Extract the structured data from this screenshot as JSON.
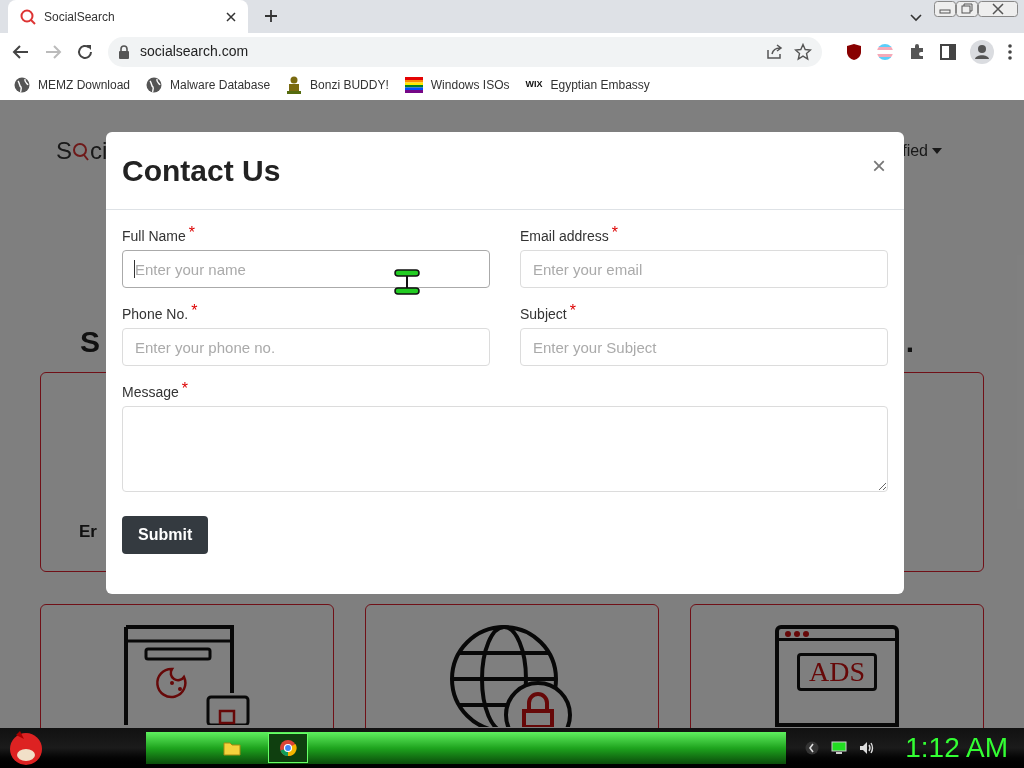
{
  "browser": {
    "tabs": [
      {
        "title": "SocialSearch",
        "selected": true
      }
    ],
    "nav": {
      "back_enabled": true,
      "forward_enabled": false
    },
    "address_bar": {
      "url": "socialsearch.com"
    },
    "bookmarks": [
      {
        "label": "MEMZ Download",
        "kind": "globe"
      },
      {
        "label": "Malware Database",
        "kind": "globe"
      },
      {
        "label": "Bonzi BUDDY!",
        "kind": "figure"
      },
      {
        "label": "Windows ISOs",
        "kind": "rainbow"
      },
      {
        "label": "Egyptian Embassy",
        "kind": "badge",
        "badge": "WIX"
      }
    ]
  },
  "page": {
    "logo": {
      "start": "S",
      "end": "ci"
    },
    "nav_item": "fied",
    "heading_start": "S",
    "heading_end": ".",
    "card_text": "Er",
    "feature_cards": [
      {
        "kind": "cookie"
      },
      {
        "kind": "globe_lock"
      },
      {
        "kind": "ads",
        "icon_text": "ADS"
      }
    ]
  },
  "modal": {
    "title": "Contact Us",
    "close": "×",
    "fields": [
      {
        "label": "Full Name",
        "required_mark": "*",
        "placeholder": "Enter your name",
        "kind": "input",
        "focused": true
      },
      {
        "label": "Email address",
        "required_mark": "*",
        "placeholder": "Enter your email",
        "kind": "input",
        "focused": false
      },
      {
        "label": "Phone No.",
        "required_mark": "*",
        "placeholder": "Enter your phone no.",
        "kind": "input",
        "focused": false
      },
      {
        "label": "Subject",
        "required_mark": "*",
        "placeholder": "Enter your Subject",
        "kind": "input",
        "focused": false
      },
      {
        "label": "Message",
        "required_mark": "*",
        "kind": "textarea",
        "focused": false
      }
    ],
    "submit": "Submit"
  },
  "taskbar": {
    "apps": [
      {
        "kind": "folder",
        "selected": false
      },
      {
        "kind": "browser",
        "selected": true
      }
    ],
    "clock": "1:12 AM"
  }
}
